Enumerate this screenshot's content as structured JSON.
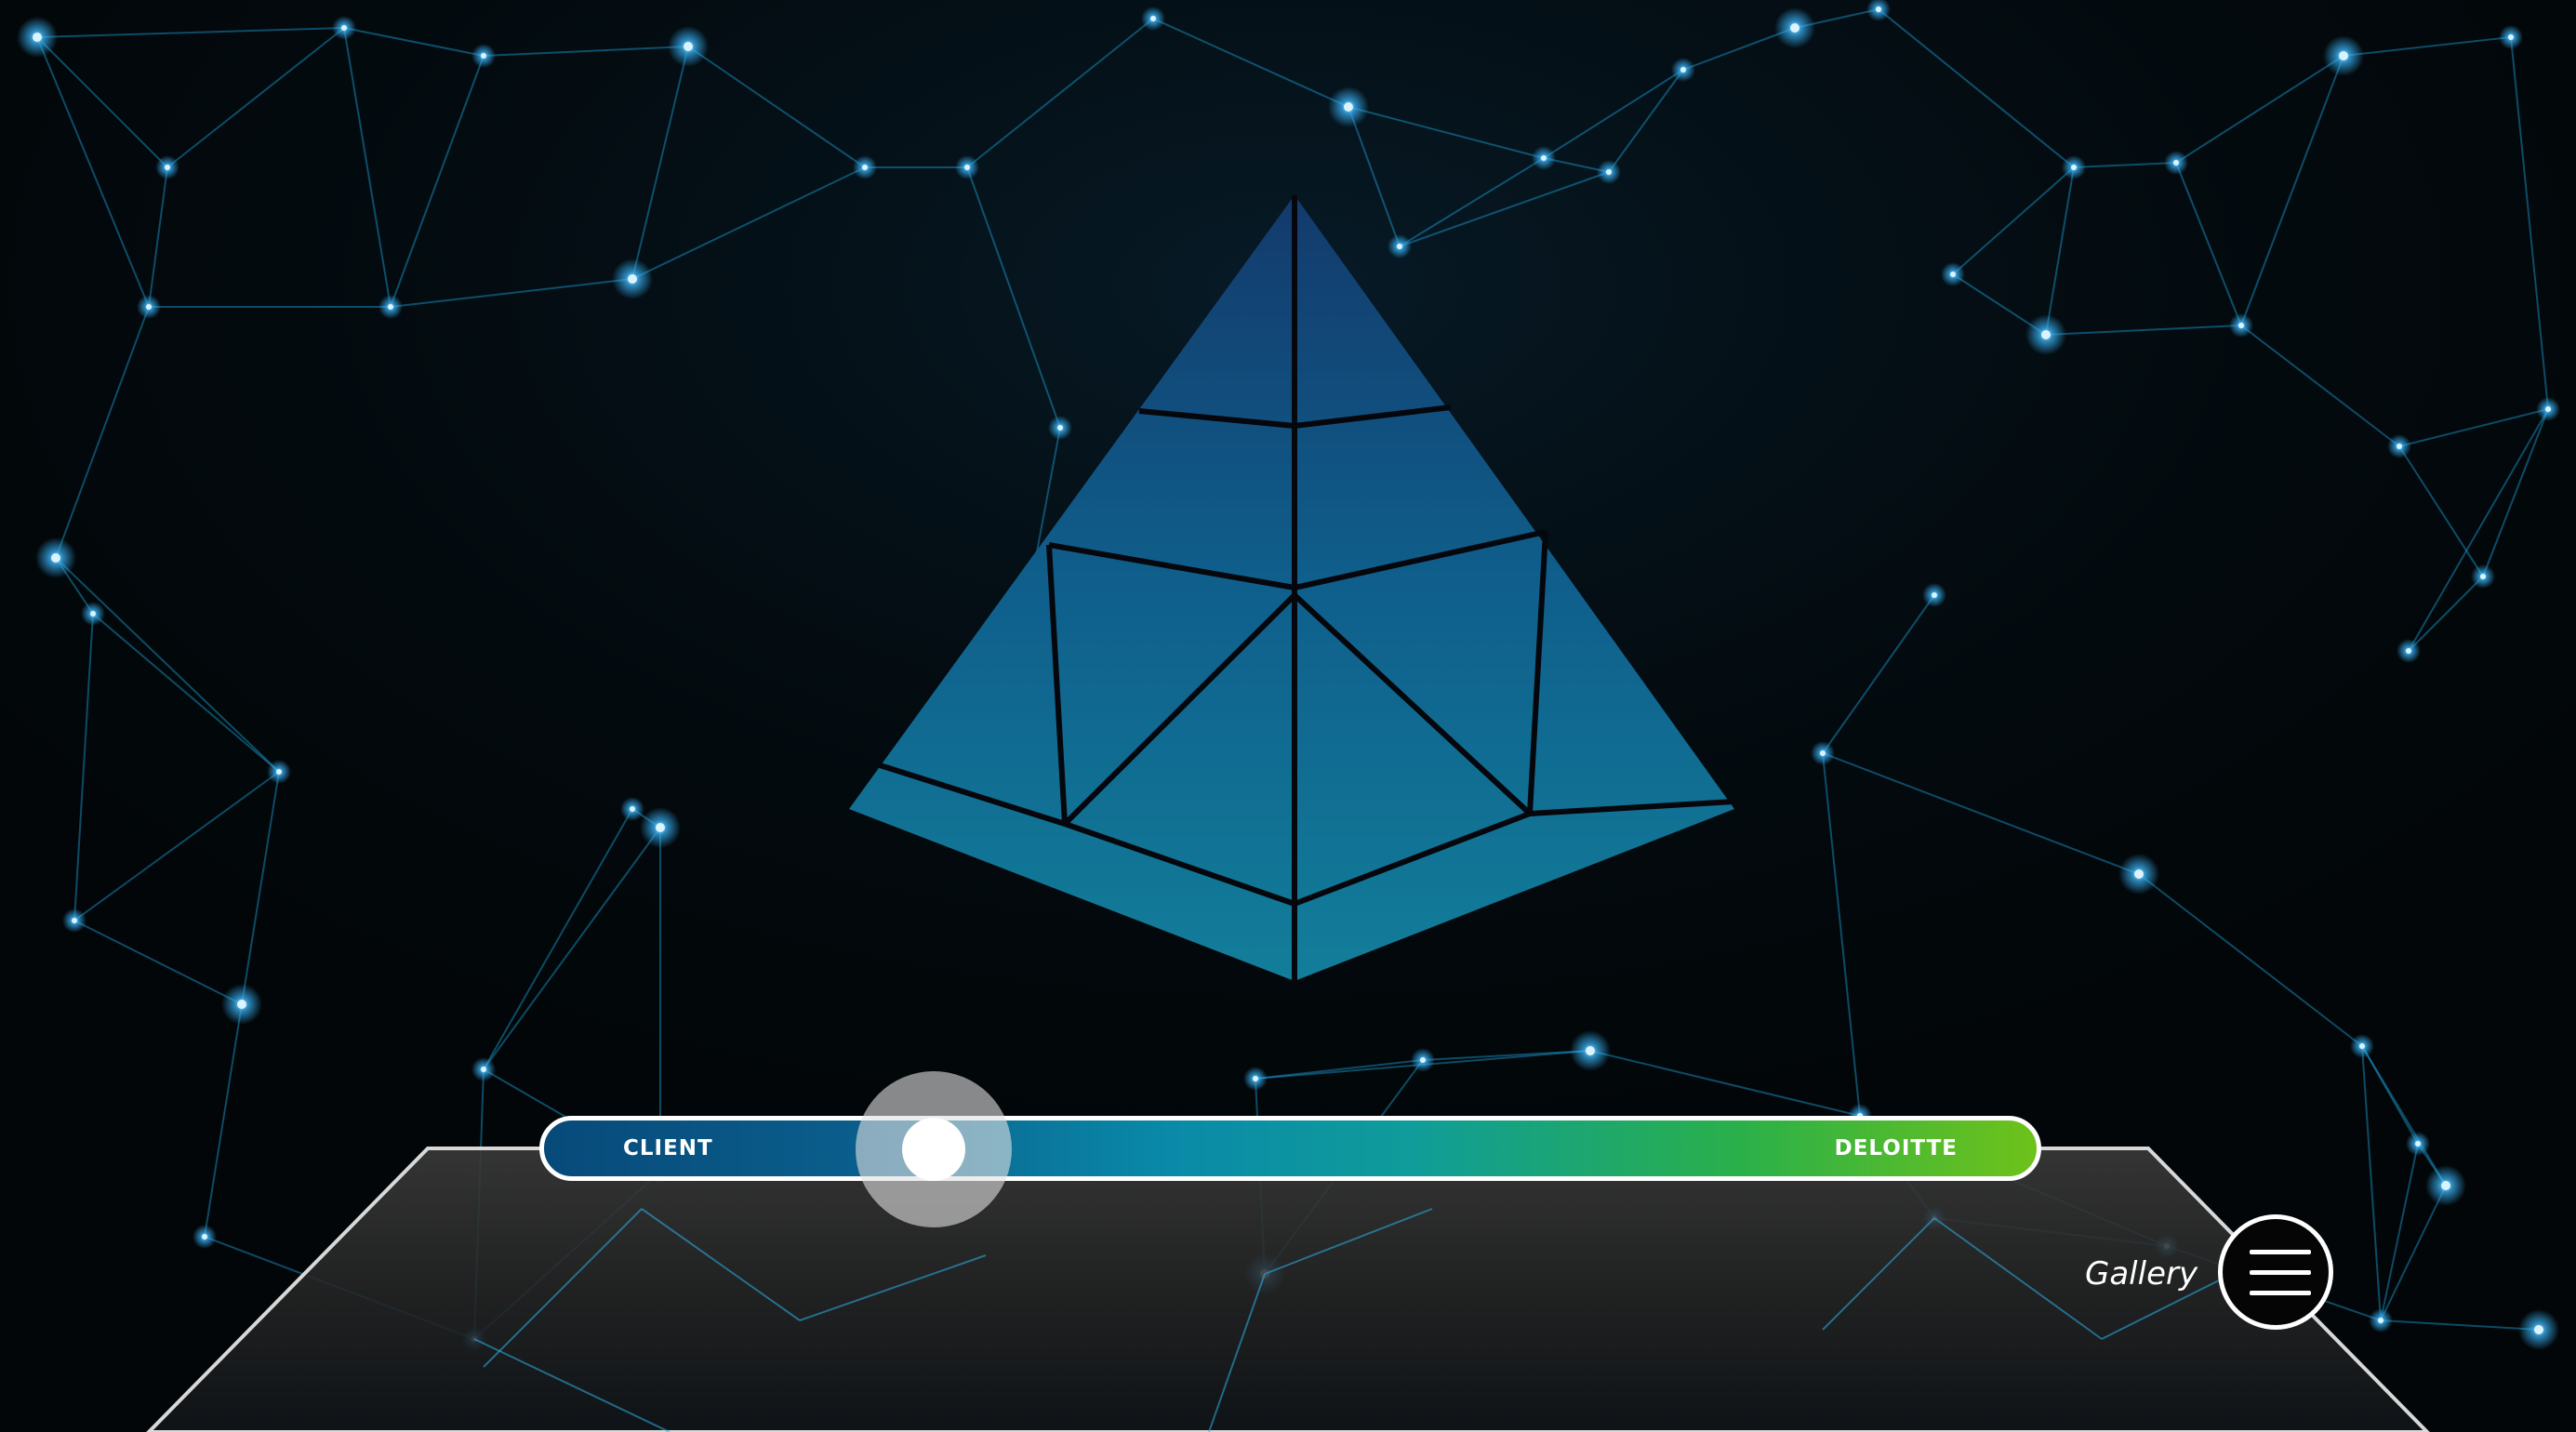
{
  "slider": {
    "left_label": "CLIENT",
    "right_label": "DELOITTE",
    "position_fraction": 0.25,
    "gradient_colors": [
      "#074a7a",
      "#0a8aa8",
      "#2ab04a",
      "#6ec21a"
    ]
  },
  "gallery": {
    "label": "Gallery",
    "icon": "hamburger-icon"
  },
  "colors": {
    "background": "#020608",
    "network_line": "#1a9fd8",
    "pyramid_top": "#133a6c",
    "pyramid_bottom": "#127e9a"
  }
}
